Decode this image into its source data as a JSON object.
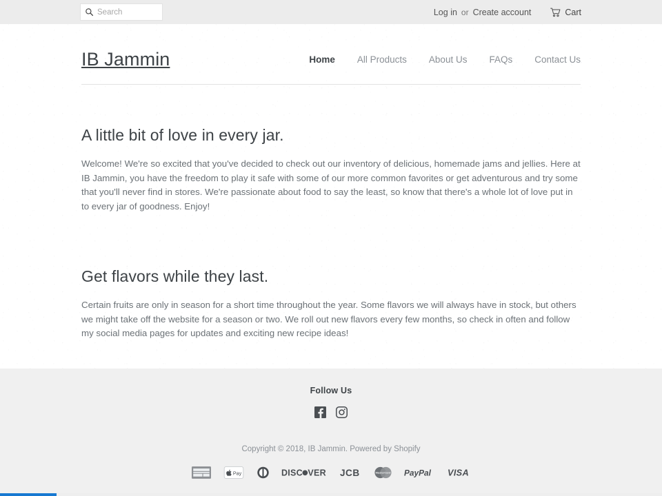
{
  "topbar": {
    "search": {
      "placeholder": "Search",
      "value": "",
      "icon": "search-icon"
    },
    "login_label": "Log in",
    "or_label": "or",
    "create_account_label": "Create account",
    "cart_label": "Cart",
    "cart_icon": "shopping-cart-icon"
  },
  "header": {
    "logo": "IB Jammin",
    "nav": [
      {
        "label": "Home",
        "active": true
      },
      {
        "label": "All Products",
        "active": false
      },
      {
        "label": "About Us",
        "active": false
      },
      {
        "label": "FAQs",
        "active": false
      },
      {
        "label": "Contact Us",
        "active": false
      }
    ]
  },
  "main": {
    "section_one": {
      "title": "A little bit of love in every jar.",
      "body": "Welcome! We're so excited that you've decided to check out our inventory of delicious, homemade jams and jellies. Here at IB Jammin, you have the freedom to play it safe with some of our more common favorites or get adventurous and try some that you'll never find in stores. We're passionate about food to say the least, so know that there's a whole lot of love put in to every jar of goodness. Enjoy!"
    },
    "section_two": {
      "title": "Get flavors while they last.",
      "body": "Certain fruits are only in season for a short time throughout the year. Some flavors we will always have in stock, but others we might take off the website for a season or two. We roll out new flavors every few months, so check in often and follow my social media pages for updates and exciting new recipe ideas!"
    }
  },
  "footer": {
    "follow_title": "Follow Us",
    "social": [
      {
        "name": "facebook-icon",
        "label": "Facebook"
      },
      {
        "name": "instagram-icon",
        "label": "Instagram"
      }
    ],
    "copyright": "Copyright © 2018, IB Jammin. Powered by Shopify",
    "payments": [
      {
        "name": "american-express-icon",
        "label": "American Express"
      },
      {
        "name": "apple-pay-icon",
        "label": "Apple Pay"
      },
      {
        "name": "diners-club-icon",
        "label": "Diners Club"
      },
      {
        "name": "discover-icon",
        "label": "Discover"
      },
      {
        "name": "jcb-icon",
        "label": "JCB"
      },
      {
        "name": "mastercard-icon",
        "label": "Master"
      },
      {
        "name": "paypal-icon",
        "label": "PayPal"
      },
      {
        "name": "visa-icon",
        "label": "VISA"
      }
    ]
  },
  "browser": {
    "loading_progress_color": "#1778d1"
  },
  "colors": {
    "topbar_bg": "#ececec",
    "footer_bg": "#f0f0f0",
    "text_dark": "#3d4246",
    "text_muted": "#6b7176",
    "nav_muted": "#8b9096",
    "rule": "#e3e3e3"
  }
}
